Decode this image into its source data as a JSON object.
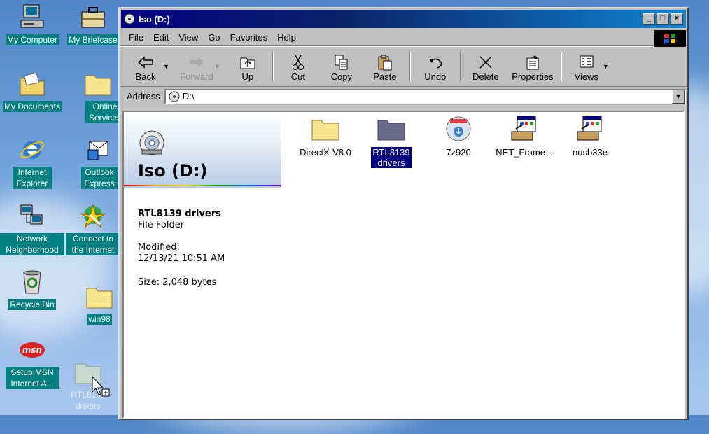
{
  "desktop": {
    "icons": [
      {
        "label": "My Computer"
      },
      {
        "label": "My Briefcase"
      },
      {
        "label": "My Documents"
      },
      {
        "label": "Online Services"
      },
      {
        "label": "Internet Explorer"
      },
      {
        "label": "Outlook Express"
      },
      {
        "label": "Network Neighborhood"
      },
      {
        "label": "Connect to the Internet"
      },
      {
        "label": "Recycle Bin"
      },
      {
        "label": "win98"
      },
      {
        "label": "Setup MSN Internet A..."
      },
      {
        "label": "RTL8139 drivers"
      }
    ]
  },
  "window": {
    "title": "Iso (D:)",
    "controls": {
      "minimize": "_",
      "maximize": "□",
      "close": "×"
    },
    "menu": [
      "File",
      "Edit",
      "View",
      "Go",
      "Favorites",
      "Help"
    ],
    "toolbar": {
      "back": "Back",
      "forward": "Forward",
      "up": "Up",
      "cut": "Cut",
      "copy": "Copy",
      "paste": "Paste",
      "undo": "Undo",
      "delete": "Delete",
      "properties": "Properties",
      "views": "Views"
    },
    "address": {
      "label": "Address",
      "value": "D:\\"
    },
    "left_pane": {
      "title": "Iso (D:)",
      "selected_name": "RTL8139 drivers",
      "selected_type": "File Folder",
      "modified_label": "Modified:",
      "modified_value": "12/13/21 10:51 AM",
      "size": "Size: 2,048 bytes"
    },
    "files": [
      {
        "name": "DirectX-V8.0",
        "icon": "folder-icon"
      },
      {
        "name": "RTL8139 drivers",
        "icon": "folder-icon",
        "selected": true
      },
      {
        "name": "7z920",
        "icon": "installer-disc-icon"
      },
      {
        "name": "NET_Frame...",
        "icon": "setup-program-icon"
      },
      {
        "name": "nusb33e",
        "icon": "setup-program-icon"
      }
    ]
  },
  "colors": {
    "titlebar": "#000080",
    "selection": "#000080",
    "desktop_label_bg": "#008080",
    "window_face": "#c0c0c0"
  }
}
